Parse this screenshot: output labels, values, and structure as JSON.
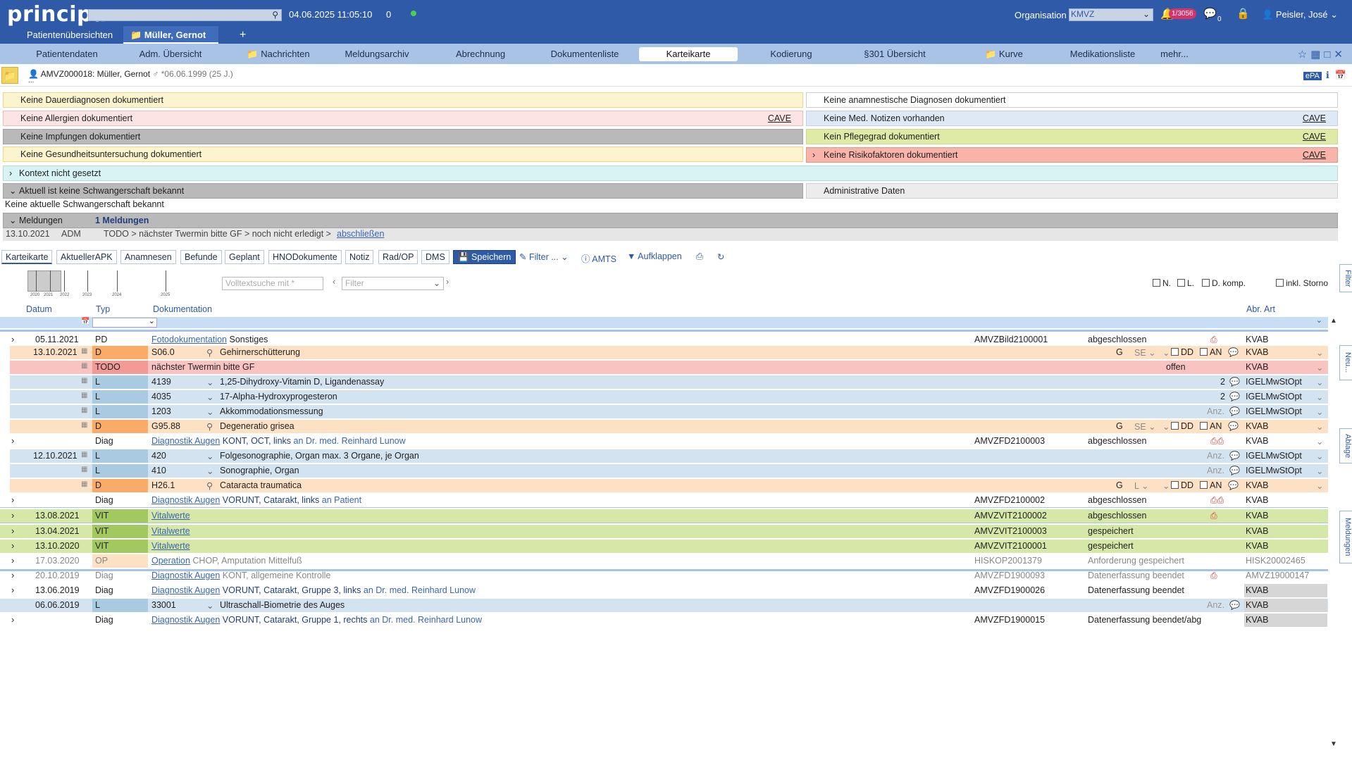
{
  "header": {
    "logo": "principa",
    "datetime": "04.06.2025 11:05:10",
    "counter": "0",
    "org_label": "Organisation",
    "org_value": "KMVZ",
    "notifications": "1/3056",
    "chat_count": "0",
    "user": "Peisler, José"
  },
  "patient_tabs": [
    "Patientenübersichten",
    "Müller, Gernot",
    "+"
  ],
  "nav": [
    "Patientendaten",
    "Adm. Übersicht",
    "Nachrichten",
    "Meldungsarchiv",
    "Abrechnung",
    "Dokumentenliste",
    "Karteikarte",
    "Kodierung",
    "§301 Übersicht",
    "Kurve",
    "Medikationsliste",
    "mehr..."
  ],
  "patient": {
    "id_name": "AMVZ000018: Müller, Gernot",
    "gender": "♂",
    "birth": "*06.06.1999 (25 J.)",
    "sub": "..."
  },
  "info_panels": {
    "dauerdiagnosen": "Keine Dauerdiagnosen dokumentiert",
    "anamnestische": "Keine anamnestische Diagnosen dokumentiert",
    "allergien": "Keine Allergien dokumentiert",
    "med_notizen": "Keine Med. Notizen vorhanden",
    "impfungen": "Keine Impfungen dokumentiert",
    "pflegegrad": "Kein Pflegegrad dokumentiert",
    "gesundheit": "Keine Gesundheitsuntersuchung dokumentiert",
    "risikofaktoren": "Keine Risikofaktoren dokumentiert",
    "kontext": "Kontext nicht gesetzt",
    "schwangerschaft": "Aktuell ist keine Schwangerschaft bekannt",
    "schwangerschaft_sub": "Keine aktuelle Schwangerschaft bekannt",
    "administrative": "Administrative Daten",
    "meldungen": "Meldungen",
    "meldungen_count": "1 Meldungen",
    "meldung_date": "13.10.2021",
    "meldung_who": "ADM",
    "meldung_text": "TODO > nächster Twermin bitte GF > noch nicht erledigt >",
    "meldung_action": "abschließen",
    "cave": "CAVE"
  },
  "tabs": [
    "Karteikarte",
    "AktuellerAPK",
    "Anamnesen",
    "Befunde",
    "Geplant",
    "HNODokumente",
    "Notiz",
    "Rad/OP",
    "DMS"
  ],
  "toolbar": {
    "save": "Speichern",
    "filter": "Filter ...",
    "amts": "AMTS",
    "aufklappen": "Aufklappen"
  },
  "timeline_years": [
    "2020",
    "2021",
    "2022",
    "2023",
    "2024",
    "2025"
  ],
  "search": {
    "volltext": "Volltextsuche mit *",
    "filter": "Filter"
  },
  "checks": [
    "N.",
    "L.",
    "D. komp.",
    "inkl. Storno"
  ],
  "columns": {
    "datum": "Datum",
    "typ": "Typ",
    "doku": "Dokumentation",
    "abr": "Abr. Art"
  },
  "side_tabs": [
    "Filter",
    "Neu...",
    "Ablage",
    "Meldungen"
  ],
  "rows": [
    {
      "date": "05.11.2021",
      "type": "PD",
      "link": "Fotodokumentation",
      "text": "Sonstiges",
      "id": "AMVZBild2100001",
      "status": "abgeschlossen",
      "abr": "KVAB"
    },
    {
      "date": "13.10.2021",
      "type": "D",
      "code": "S06.0",
      "text": "Gehirnerschütterung",
      "g": "G",
      "se": "SE",
      "abr": "KVAB"
    },
    {
      "type": "TODO",
      "text": "nächster Twermin bitte GF",
      "status": "offen",
      "abr": "KVAB"
    },
    {
      "type": "L",
      "code": "4139",
      "text": "1,25-Dihydroxy-Vitamin D, Ligandenassay",
      "qty": "2",
      "abr": "IGELMwStOpt"
    },
    {
      "type": "L",
      "code": "4035",
      "text": "17-Alpha-Hydroxyprogesteron",
      "qty": "2",
      "abr": "IGELMwStOpt"
    },
    {
      "type": "L",
      "code": "1203",
      "text": "Akkommodationsmessung",
      "qty": "Anz.",
      "abr": "IGELMwStOpt"
    },
    {
      "type": "D",
      "code": "G95.88",
      "text": "Degeneratio grisea",
      "g": "G",
      "se": "SE",
      "abr": "KVAB"
    },
    {
      "type": "Diag",
      "link": "Diagnostik Augen",
      "bold": "KONT, OCT, links",
      "text2": "an Dr. med. Reinhard Lunow",
      "id": "AMVZFD2100003",
      "status": "abgeschlossen",
      "abr": "KVAB"
    },
    {
      "date": "12.10.2021",
      "type": "L",
      "code": "420",
      "text": "Folgesonographie, Organ max. 3 Organe, je Organ",
      "qty": "Anz.",
      "abr": "IGELMwStOpt"
    },
    {
      "type": "L",
      "code": "410",
      "text": "Sonographie, Organ",
      "qty": "Anz.",
      "abr": "IGELMwStOpt"
    },
    {
      "type": "D",
      "code": "H26.1",
      "text": "Cataracta traumatica",
      "g": "G",
      "se": "L",
      "abr": "KVAB"
    },
    {
      "type": "Diag",
      "link": "Diagnostik Augen",
      "bold": "VORUNT, Catarakt, links",
      "text2": "an Patient",
      "id": "AMVZFD2100002",
      "status": "abgeschlossen",
      "abr": "KVAB"
    },
    {
      "date": "13.08.2021",
      "type": "VIT",
      "link": "Vitalwerte",
      "id": "AMVZVIT2100002",
      "status": "abgeschlossen",
      "abr": "KVAB"
    },
    {
      "date": "13.04.2021",
      "type": "VIT",
      "link": "Vitalwerte",
      "id": "AMVZVIT2100003",
      "status": "gespeichert",
      "abr": "KVAB"
    },
    {
      "date": "13.10.2020",
      "type": "VIT",
      "link": "Vitalwerte",
      "id": "AMVZVIT2100001",
      "status": "gespeichert",
      "abr": "KVAB"
    },
    {
      "date": "17.03.2020",
      "type": "OP",
      "link": "Operation",
      "text": "CHOP, Amputation Mittelfuß",
      "id": "HISKOP2001379",
      "status": "Anforderung gespeichert",
      "abr": "HISK20002465"
    },
    {
      "date": "20.10.2019",
      "type": "Diag",
      "link": "Diagnostik Augen",
      "text": "KONT, allgemeine Kontrolle",
      "id": "AMVZFD1900093",
      "status": "Datenerfassung beendet",
      "abr": "AMVZ19000147"
    },
    {
      "date": "13.06.2019",
      "type": "Diag",
      "link": "Diagnostik Augen",
      "bold": "VORUNT, Catarakt, Gruppe 3, links",
      "text2": "an Dr. med. Reinhard Lunow",
      "id": "AMVZFD1900026",
      "status": "Datenerfassung beendet",
      "abr": "KVAB"
    },
    {
      "date": "06.06.2019",
      "type": "L",
      "code": "33001",
      "text": "Ultraschall-Biometrie des Auges",
      "qty": "Anz.",
      "abr": "KVAB"
    },
    {
      "type": "Diag",
      "link": "Diagnostik Augen",
      "bold": "VORUNT, Catarakt, Gruppe 1, rechts",
      "text2": "an Dr. med. Reinhard Lunow",
      "id": "AMVZFD1900015",
      "status": "Datenerfassung beendet/abg",
      "abr": "KVAB"
    }
  ],
  "labels": {
    "dd": "DD",
    "an": "AN"
  }
}
